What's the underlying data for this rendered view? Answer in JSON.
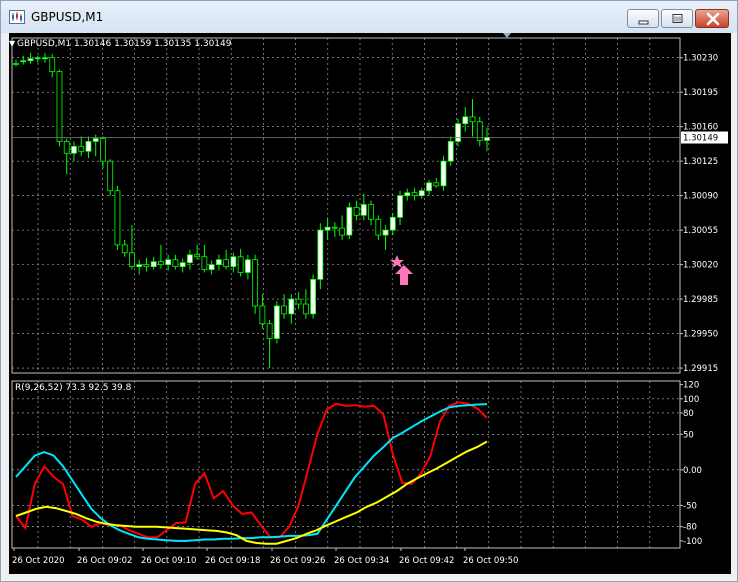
{
  "window": {
    "title": "GBPUSD,M1"
  },
  "main_chart": {
    "header": "GBPUSD,M1  1.30146 1.30159 1.30135 1.30149",
    "price_labels": [
      "1.30230",
      "1.30195",
      "1.30160",
      "1.30125",
      "1.30090",
      "1.30055",
      "1.30020",
      "1.29985",
      "1.29950",
      "1.29915"
    ],
    "current_price": "1.30149",
    "colors": {
      "background": "#000000",
      "bull_candle": "#ffffff",
      "bear_candle": "#000000",
      "candle_outline": "#00ff00",
      "grid": "#c0c0c0",
      "arrow": "#ff77bb"
    }
  },
  "chart_data": [
    {
      "type": "candlestick",
      "symbol": "GBPUSD",
      "timeframe": "M1",
      "last_price": 1.30149,
      "ohlc": [
        [
          1.30224,
          1.30228,
          1.30221,
          1.30223
        ],
        [
          1.30226,
          1.30232,
          1.30223,
          1.30227
        ],
        [
          1.30227,
          1.30235,
          1.30224,
          1.30229
        ],
        [
          1.30229,
          1.30232,
          1.30225,
          1.3023
        ],
        [
          1.3023,
          1.30235,
          1.30225,
          1.3023
        ],
        [
          1.3023,
          1.30234,
          1.3021,
          1.30216
        ],
        [
          1.30216,
          1.30218,
          1.3014,
          1.30145
        ],
        [
          1.30145,
          1.30148,
          1.30112,
          1.30133
        ],
        [
          1.30133,
          1.30145,
          1.30125,
          1.3014
        ],
        [
          1.3014,
          1.3015,
          1.3013,
          1.30135
        ],
        [
          1.30135,
          1.3015,
          1.30128,
          1.30145
        ],
        [
          1.30145,
          1.30152,
          1.3013,
          1.30148
        ],
        [
          1.30148,
          1.3015,
          1.30118,
          1.30125
        ],
        [
          1.30125,
          1.30127,
          1.3009,
          1.30095
        ],
        [
          1.30095,
          1.301,
          1.30035,
          1.3004
        ],
        [
          1.3004,
          1.30045,
          1.30028,
          1.30032
        ],
        [
          1.30032,
          1.3006,
          1.30015,
          1.30018
        ],
        [
          1.30018,
          1.30025,
          1.3001,
          1.3002
        ],
        [
          1.3002,
          1.30027,
          1.30013,
          1.30018
        ],
        [
          1.30018,
          1.30028,
          1.30015,
          1.30023
        ],
        [
          1.30023,
          1.3004,
          1.30016,
          1.3002
        ],
        [
          1.3002,
          1.3003,
          1.30014,
          1.30025
        ],
        [
          1.30025,
          1.3003,
          1.30015,
          1.30018
        ],
        [
          1.30018,
          1.30026,
          1.30012,
          1.30022
        ],
        [
          1.30022,
          1.30035,
          1.30015,
          1.3003
        ],
        [
          1.3003,
          1.3004,
          1.30025,
          1.30028
        ],
        [
          1.30028,
          1.3004,
          1.30012,
          1.30015
        ],
        [
          1.30015,
          1.30024,
          1.3001,
          1.3002
        ],
        [
          1.3002,
          1.3003,
          1.30014,
          1.30025
        ],
        [
          1.30025,
          1.30035,
          1.30015,
          1.30018
        ],
        [
          1.30018,
          1.30032,
          1.30012,
          1.30028
        ],
        [
          1.30028,
          1.30036,
          1.30008,
          1.30012
        ],
        [
          1.30012,
          1.3003,
          1.30005,
          1.30025
        ],
        [
          1.30025,
          1.3003,
          1.2997,
          1.29978
        ],
        [
          1.29978,
          1.2999,
          1.29955,
          1.2996
        ],
        [
          1.2996,
          1.29964,
          1.29915,
          1.29945
        ],
        [
          1.29945,
          1.29983,
          1.2994,
          1.29978
        ],
        [
          1.29978,
          1.2999,
          1.29965,
          1.2997
        ],
        [
          1.2997,
          1.2999,
          1.2996,
          1.29985
        ],
        [
          1.29985,
          1.29992,
          1.29975,
          1.2998
        ],
        [
          1.2998,
          1.29995,
          1.29965,
          1.2997
        ],
        [
          1.2997,
          1.3001,
          1.29965,
          1.30005
        ],
        [
          1.30005,
          1.30062,
          1.29995,
          1.30055
        ],
        [
          1.30055,
          1.30068,
          1.30045,
          1.30058
        ],
        [
          1.30058,
          1.30063,
          1.30048,
          1.30057
        ],
        [
          1.30057,
          1.3007,
          1.30045,
          1.3005
        ],
        [
          1.3005,
          1.30083,
          1.30046,
          1.30078
        ],
        [
          1.30078,
          1.30085,
          1.30065,
          1.3007
        ],
        [
          1.3007,
          1.30092,
          1.30065,
          1.30081
        ],
        [
          1.30081,
          1.30085,
          1.3006,
          1.30066
        ],
        [
          1.30066,
          1.3007,
          1.30045,
          1.3005
        ],
        [
          1.3005,
          1.3006,
          1.30035,
          1.30055
        ],
        [
          1.30055,
          1.30072,
          1.3005,
          1.30068
        ],
        [
          1.30068,
          1.30095,
          1.3006,
          1.3009
        ],
        [
          1.3009,
          1.30097,
          1.30085,
          1.30093
        ],
        [
          1.30093,
          1.30098,
          1.30085,
          1.3009
        ],
        [
          1.3009,
          1.30098,
          1.30087,
          1.30095
        ],
        [
          1.30095,
          1.30106,
          1.3009,
          1.30103
        ],
        [
          1.30103,
          1.30108,
          1.30098,
          1.301
        ],
        [
          1.301,
          1.3013,
          1.30095,
          1.30125
        ],
        [
          1.30125,
          1.3015,
          1.3012,
          1.30145
        ],
        [
          1.30145,
          1.30168,
          1.3014,
          1.30163
        ],
        [
          1.30163,
          1.3018,
          1.30155,
          1.3017
        ],
        [
          1.3017,
          1.30188,
          1.3015,
          1.30165
        ],
        [
          1.30165,
          1.3017,
          1.3014,
          1.30146
        ],
        [
          1.30146,
          1.30159,
          1.30135,
          1.30149
        ]
      ],
      "price_range": [
        1.2991,
        1.3025
      ],
      "grid": true,
      "signal": {
        "type": "buy-arrow",
        "color": "#ff77bb"
      }
    },
    {
      "type": "line",
      "title": "R(9,26,52) 73.3 92.5 39.8",
      "xlabel": "",
      "ylabel": "",
      "ylim": [
        -110,
        125
      ],
      "y_ticks": [
        "120",
        "100",
        "80",
        "50",
        "0.00",
        "-50",
        "-80",
        "-100"
      ],
      "x_ticks": [
        "26 Oct 2020",
        "26 Oct 09:02",
        "26 Oct 09:10",
        "26 Oct 09:18",
        "26 Oct 09:26",
        "26 Oct 09:34",
        "26 Oct 09:42",
        "26 Oct 09:50"
      ],
      "grid": true,
      "series": [
        {
          "color": "#ff0000",
          "values": [
            -65,
            -82,
            -20,
            5,
            -10,
            -20,
            -65,
            -70,
            -80,
            -75,
            -78,
            -78,
            -85,
            -90,
            -95,
            -95,
            -85,
            -75,
            -74,
            -20,
            -5,
            -40,
            -30,
            -50,
            -62,
            -60,
            -78,
            -95,
            -95,
            -80,
            -50,
            0,
            50,
            85,
            93,
            90,
            91,
            89,
            90,
            78,
            22,
            -18,
            -20,
            -5,
            20,
            68,
            90,
            95,
            93,
            86,
            73
          ]
        },
        {
          "color": "#00e5ff",
          "values": [
            -10,
            5,
            20,
            25,
            20,
            5,
            -15,
            -35,
            -55,
            -68,
            -78,
            -85,
            -90,
            -95,
            -97,
            -98,
            -99,
            -100,
            -100,
            -99,
            -98,
            -98,
            -97,
            -97,
            -96,
            -96,
            -95,
            -95,
            -94,
            -93,
            -93,
            -92,
            -90,
            -70,
            -50,
            -30,
            -10,
            5,
            20,
            32,
            45,
            52,
            60,
            68,
            75,
            82,
            88,
            90,
            91,
            92,
            92.5
          ]
        },
        {
          "color": "#ffff00",
          "values": [
            -65,
            -60,
            -55,
            -52,
            -54,
            -58,
            -62,
            -68,
            -73,
            -76,
            -78,
            -79,
            -80,
            -80,
            -80,
            -81,
            -82,
            -83,
            -84,
            -85,
            -86,
            -88,
            -92,
            -100,
            -103,
            -104,
            -104,
            -100,
            -96,
            -90,
            -85,
            -78,
            -72,
            -66,
            -60,
            -52,
            -46,
            -38,
            -30,
            -20,
            -12,
            -5,
            2,
            10,
            18,
            26,
            32,
            39.8
          ]
        }
      ]
    }
  ]
}
